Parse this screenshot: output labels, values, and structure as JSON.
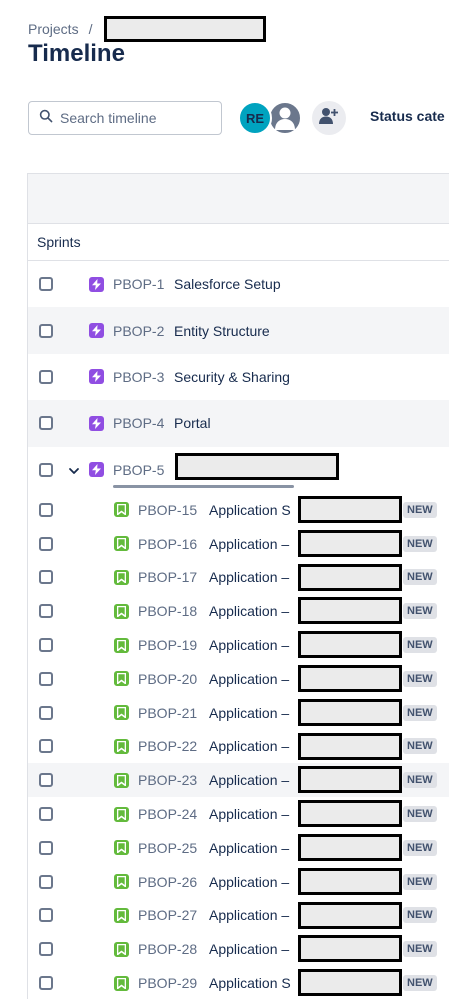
{
  "breadcrumb": {
    "root": "Projects",
    "separator": "/",
    "project": ""
  },
  "page": {
    "title": "Timeline"
  },
  "toolbar": {
    "search_placeholder": "Search timeline",
    "avatar_initials": "RE",
    "status_label": "Status cate"
  },
  "grid": {
    "sprints_label": "Sprints"
  },
  "epics": [
    {
      "key": "PBOP-1",
      "summary": "Salesforce Setup"
    },
    {
      "key": "PBOP-2",
      "summary": "Entity Structure"
    },
    {
      "key": "PBOP-3",
      "summary": "Security & Sharing"
    },
    {
      "key": "PBOP-4",
      "summary": "Portal"
    },
    {
      "key": "PBOP-5",
      "summary": ""
    }
  ],
  "stories": [
    {
      "key": "PBOP-15",
      "summary": "Application S",
      "status": "NEW"
    },
    {
      "key": "PBOP-16",
      "summary": "Application –",
      "status": "NEW"
    },
    {
      "key": "PBOP-17",
      "summary": "Application –",
      "status": "NEW"
    },
    {
      "key": "PBOP-18",
      "summary": "Application –",
      "status": "NEW"
    },
    {
      "key": "PBOP-19",
      "summary": "Application –",
      "status": "NEW"
    },
    {
      "key": "PBOP-20",
      "summary": "Application –",
      "status": "NEW"
    },
    {
      "key": "PBOP-21",
      "summary": "Application –",
      "status": "NEW"
    },
    {
      "key": "PBOP-22",
      "summary": "Application –",
      "status": "NEW"
    },
    {
      "key": "PBOP-23",
      "summary": "Application –",
      "status": "NEW"
    },
    {
      "key": "PBOP-24",
      "summary": "Application –",
      "status": "NEW"
    },
    {
      "key": "PBOP-25",
      "summary": "Application –",
      "status": "NEW"
    },
    {
      "key": "PBOP-26",
      "summary": "Application –",
      "status": "NEW"
    },
    {
      "key": "PBOP-27",
      "summary": "Application –",
      "status": "NEW"
    },
    {
      "key": "PBOP-28",
      "summary": "Application –",
      "status": "NEW"
    },
    {
      "key": "PBOP-29",
      "summary": "Application S",
      "status": "NEW"
    }
  ],
  "icons": {
    "epic": "lightning-icon",
    "story": "bookmark-icon",
    "search": "search-icon",
    "add_people": "add-person-icon",
    "expand": "chevron-down-icon"
  },
  "colors": {
    "epic": "#904ee2",
    "story": "#63ba3c",
    "avatar": "#00a3bf",
    "text": "#172b4d",
    "muted": "#5e6c84"
  }
}
